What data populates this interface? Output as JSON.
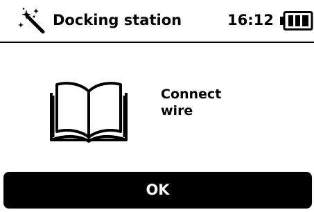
{
  "header": {
    "title": "Docking station",
    "time": "16:12",
    "left_icon": "wizard-wand-icon",
    "battery_icon": "battery-icon"
  },
  "content": {
    "illustration_icon": "open-manual-book-icon",
    "message_line1": "Connect",
    "message_line2": "wire"
  },
  "actions": {
    "ok_label": "OK"
  },
  "colors": {
    "background": "#ffffff",
    "foreground": "#000000",
    "button_background": "#000000",
    "button_text": "#ffffff"
  }
}
